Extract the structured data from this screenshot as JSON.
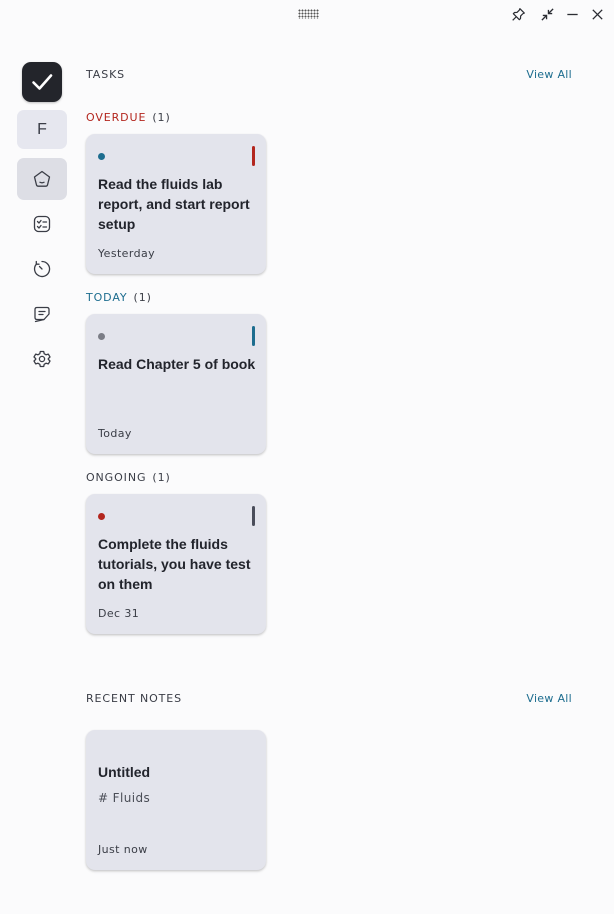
{
  "window": {
    "icons": [
      "drag-handle",
      "pin-icon",
      "collapse-icon",
      "minimize-icon",
      "close-icon"
    ]
  },
  "sidebar": {
    "avatar_letter": "F",
    "items": [
      {
        "icon": "home-icon",
        "active": true
      },
      {
        "icon": "tasks-icon",
        "active": false
      },
      {
        "icon": "timer-icon",
        "active": false
      },
      {
        "icon": "notes-icon",
        "active": false
      },
      {
        "icon": "settings-icon",
        "active": false
      }
    ]
  },
  "tasks": {
    "title": "TASKS",
    "view_all": "View All",
    "groups": [
      {
        "label": "OVERDUE",
        "count": "(1)",
        "color": "#b3261e",
        "card": {
          "title": "Read the fluids lab report, and start report setup",
          "date": "Yesterday",
          "dot_color": "#1d6d8f",
          "bar_color": "#b3261e"
        }
      },
      {
        "label": "TODAY",
        "count": "(1)",
        "color": "#1d6d8f",
        "card": {
          "title": "Read Chapter 5 of book",
          "date": "Today",
          "dot_color": "#7b7d86",
          "bar_color": "#1d6d8f"
        }
      },
      {
        "label": "ONGOING",
        "count": "(1)",
        "color": "#3a3d46",
        "card": {
          "title": "Complete the fluids tutorials, you have test on them",
          "date": "Dec 31",
          "dot_color": "#b3261e",
          "bar_color": "#4a4d5a"
        }
      }
    ]
  },
  "notes": {
    "title": "RECENT NOTES",
    "view_all": "View All",
    "items": [
      {
        "title": "Untitled",
        "tag": "# Fluids",
        "time": "Just now"
      }
    ]
  }
}
